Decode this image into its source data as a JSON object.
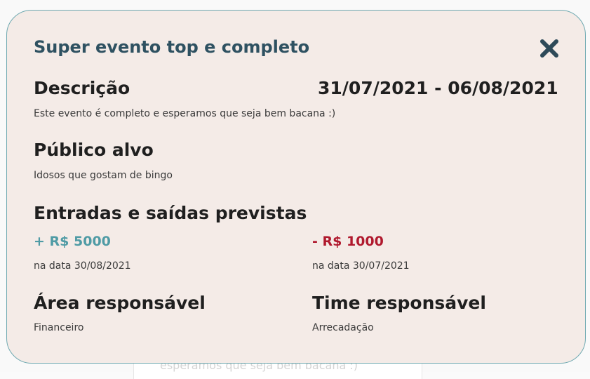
{
  "background": {
    "faded_text": "esperamos que seja bem bacana :)"
  },
  "modal": {
    "title": "Super evento top e completo",
    "close_icon": "close-x-icon",
    "description": {
      "heading": "Descrição",
      "date_range": "31/07/2021 - 06/08/2021",
      "text": "Este evento é completo e esperamos que seja bem bacana :)"
    },
    "audience": {
      "heading": "Público alvo",
      "text": "Idosos que gostam de bingo"
    },
    "cashflow": {
      "heading": "Entradas e saídas previstas",
      "income": {
        "amount": "+ R$ 5000",
        "date_text": "na data 30/08/2021"
      },
      "expense": {
        "amount": "- R$ 1000",
        "date_text": "na data 30/07/2021"
      }
    },
    "area": {
      "heading": "Área responsável",
      "text": "Financeiro"
    },
    "team": {
      "heading": "Time responsável",
      "text": "Arrecadação"
    }
  },
  "colors": {
    "modal_background": "#f4ebe7",
    "modal_border": "#6fa9b1",
    "title": "#2e5161",
    "income": "#4f9ba5",
    "expense": "#b0192e",
    "close_icon": "#2e4a59"
  }
}
